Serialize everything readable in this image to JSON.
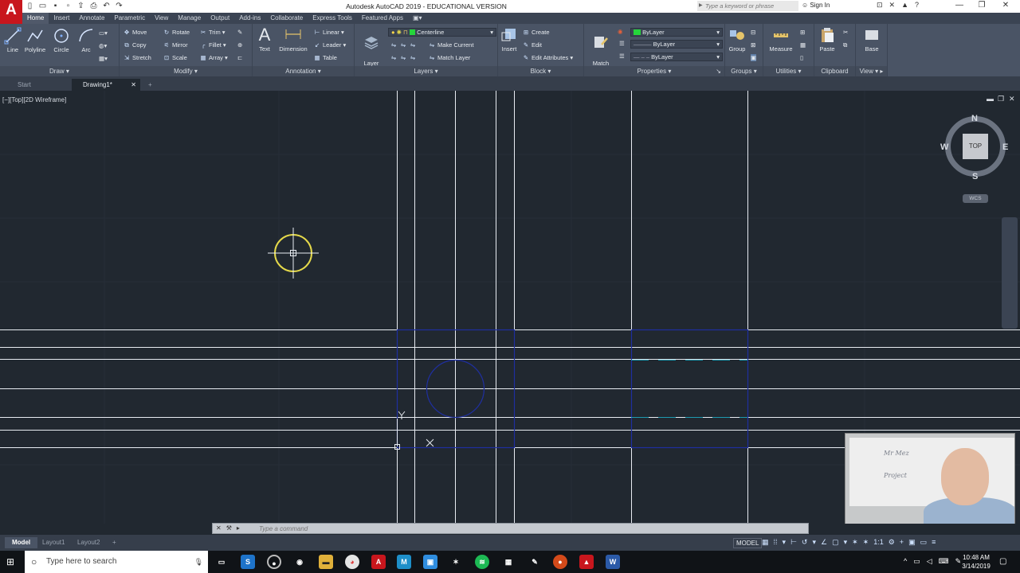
{
  "titlebar": {
    "title": "Autodesk AutoCAD 2019 - EDUCATIONAL VERSION",
    "logo": "A",
    "search_placeholder": "Type a keyword or phrase",
    "signin": "Sign In"
  },
  "ribbon_tabs": [
    "Home",
    "Insert",
    "Annotate",
    "Parametric",
    "View",
    "Manage",
    "Output",
    "Add-ins",
    "Collaborate",
    "Express Tools",
    "Featured Apps"
  ],
  "ribbon": {
    "draw": {
      "title": "Draw",
      "tools": [
        "Line",
        "Polyline",
        "Circle",
        "Arc"
      ]
    },
    "modify": {
      "title": "Modify",
      "tools": [
        "Move",
        "Rotate",
        "Trim",
        "Copy",
        "Mirror",
        "Fillet",
        "Stretch",
        "Scale",
        "Array"
      ]
    },
    "annotation": {
      "title": "Annotation",
      "tools": [
        "Text",
        "Dimension"
      ],
      "small": [
        "Linear",
        "Leader",
        "Table"
      ]
    },
    "layers": {
      "title": "Layers",
      "layer_props": "Layer\nProperties",
      "current_layer": "Centerline",
      "small": [
        "Make Current",
        "Match Layer"
      ]
    },
    "block": {
      "title": "Block",
      "insert": "Insert",
      "small": [
        "Create",
        "Edit",
        "Edit Attributes"
      ]
    },
    "properties": {
      "title": "Properties",
      "match": "Match\nProperties",
      "color": "ByLayer",
      "linetype": "ByLayer",
      "lineweight": "ByLayer"
    },
    "groups": {
      "title": "Groups",
      "group": "Group"
    },
    "utilities": {
      "title": "Utilities",
      "measure": "Measure"
    },
    "clipboard": {
      "title": "Clipboard",
      "paste": "Paste"
    },
    "view": {
      "title": "View",
      "base": "Base"
    }
  },
  "file_tabs": [
    "Start",
    "Drawing1*"
  ],
  "viewport": {
    "label": "[−][Top][2D Wireframe]",
    "viewcube": {
      "top": "TOP",
      "n": "N",
      "s": "S",
      "e": "E",
      "w": "W",
      "wcs": "WCS"
    }
  },
  "webcam": {
    "scribble1": "Mr Mez",
    "scribble2": "Project"
  },
  "command": {
    "placeholder": "Type a command"
  },
  "layout_tabs": [
    "Model",
    "Layout1",
    "Layout2"
  ],
  "status": {
    "model": "MODEL",
    "scale": "1:1"
  },
  "taskbar": {
    "search_placeholder": "Type here to search",
    "time": "10:48 AM",
    "date": "3/14/2019"
  },
  "colors": {
    "canvas": "#212830",
    "ribbon": "#4a5465",
    "line_white": "#e8ecf2",
    "line_blue": "#1f2fa0",
    "cursor_yellow": "#e5d94a",
    "cyan": "#1f9ab0"
  }
}
